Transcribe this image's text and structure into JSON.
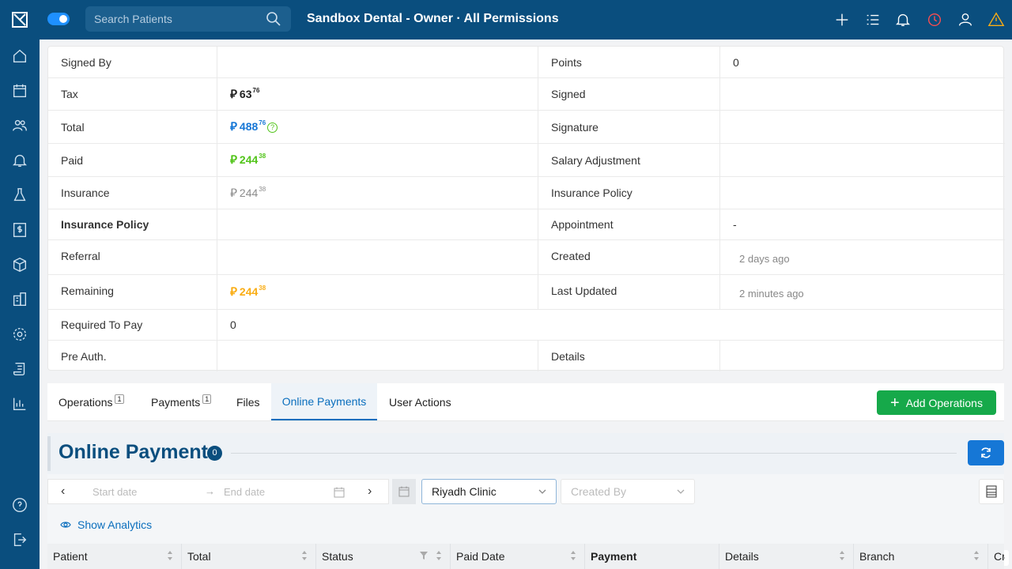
{
  "header": {
    "search_placeholder": "Search Patients",
    "title": "Sandbox Dental - Owner · All Permissions"
  },
  "details": {
    "rows": [
      {
        "label": "Signed By",
        "value": "",
        "label2": "Points",
        "value2": "0"
      },
      {
        "label": "Tax",
        "value_int": "63",
        "value_dec": "76",
        "label2": "Signed",
        "value2": ""
      },
      {
        "label": "Total",
        "value_int": "488",
        "value_dec": "76",
        "label2": "Signature",
        "value2": ""
      },
      {
        "label": "Paid",
        "value_int": "244",
        "value_dec": "38",
        "label2": "Salary Adjustment",
        "value2": ""
      },
      {
        "label": "Insurance",
        "value_int": "244",
        "value_dec": "38",
        "label2": "Insurance Policy",
        "value2": ""
      },
      {
        "label": "Insurance Policy",
        "value": "",
        "label2": "Appointment",
        "value2": "-"
      },
      {
        "label": "Referral",
        "value": "",
        "label2": "Created",
        "value2": "2 days ago"
      },
      {
        "label": "Remaining",
        "value_int": "244",
        "value_dec": "38",
        "label2": "Last Updated",
        "value2": "2 minutes ago"
      },
      {
        "label": "Required To Pay",
        "value": "0"
      },
      {
        "label": "Pre Auth.",
        "value": "",
        "label2": "Details",
        "value2": ""
      }
    ],
    "currency_symbol": "⃁"
  },
  "tabs": [
    {
      "label": "Operations",
      "badge": "1"
    },
    {
      "label": "Payments",
      "badge": "1"
    },
    {
      "label": "Files"
    },
    {
      "label": "Online Payments"
    },
    {
      "label": "User Actions"
    }
  ],
  "add_operations_label": "Add Operations",
  "online_payments": {
    "title": "Online Payments",
    "count": "0",
    "start_placeholder": "Start date",
    "end_placeholder": "End date",
    "clinic": "Riyadh Clinic",
    "created_by_placeholder": "Created By",
    "show_analytics": "Show Analytics",
    "columns": [
      "Patient",
      "Total",
      "Status",
      "Paid Date",
      "Payment",
      "Details",
      "Branch",
      "Cr"
    ]
  },
  "colors": {
    "sidebar": "#0a4e7e",
    "accent": "#1677d6",
    "green": "#16a94a"
  }
}
